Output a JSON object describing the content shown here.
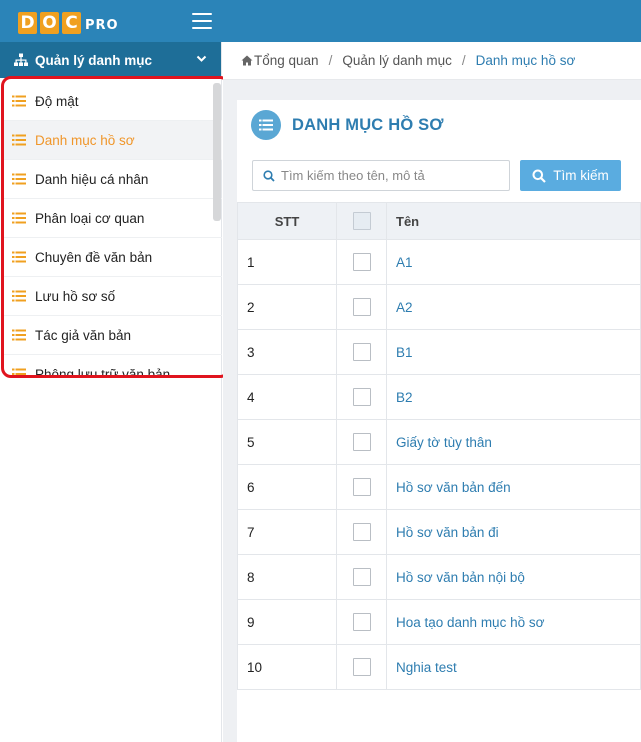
{
  "app": {
    "logo_letters": [
      "D",
      "O",
      "C"
    ],
    "logo_suffix": "PRO"
  },
  "colors": {
    "header": "#2b84b8",
    "sidebar_header": "#1e6e98",
    "accent": "#2e7db0",
    "active": "#f0962a",
    "highlight_box": "#e0141e"
  },
  "sidebar": {
    "title": "Quản lý danh mục",
    "items": [
      {
        "label": "Độ mật",
        "active": false
      },
      {
        "label": "Danh mục hồ sơ",
        "active": true
      },
      {
        "label": "Danh hiệu cá nhân",
        "active": false
      },
      {
        "label": "Phân loại cơ quan",
        "active": false
      },
      {
        "label": "Chuyên đề văn bản",
        "active": false
      },
      {
        "label": "Lưu hồ sơ số",
        "active": false
      },
      {
        "label": "Tác giả văn bản",
        "active": false
      },
      {
        "label": "Phông lưu trữ văn bản",
        "active": false
      }
    ]
  },
  "breadcrumb": {
    "home": "Tổng quan",
    "level1": "Quản lý danh mục",
    "current": "Danh mục hồ sơ",
    "separator": "/"
  },
  "panel": {
    "title": "DANH MỤC HỒ SƠ",
    "search_placeholder": "Tìm kiếm theo tên, mô tả",
    "search_button": "Tìm kiếm"
  },
  "table": {
    "headers": {
      "stt": "STT",
      "name": "Tên"
    },
    "rows": [
      {
        "stt": "1",
        "name": "A1"
      },
      {
        "stt": "2",
        "name": "A2"
      },
      {
        "stt": "3",
        "name": "B1"
      },
      {
        "stt": "4",
        "name": "B2"
      },
      {
        "stt": "5",
        "name": "Giấy tờ tùy thân"
      },
      {
        "stt": "6",
        "name": "Hồ sơ văn bản đến"
      },
      {
        "stt": "7",
        "name": "Hồ sơ văn bản đi"
      },
      {
        "stt": "8",
        "name": "Hồ sơ văn bản nội bộ"
      },
      {
        "stt": "9",
        "name": "Hoa tạo danh mục hồ sơ"
      },
      {
        "stt": "10",
        "name": "Nghia test"
      }
    ]
  }
}
